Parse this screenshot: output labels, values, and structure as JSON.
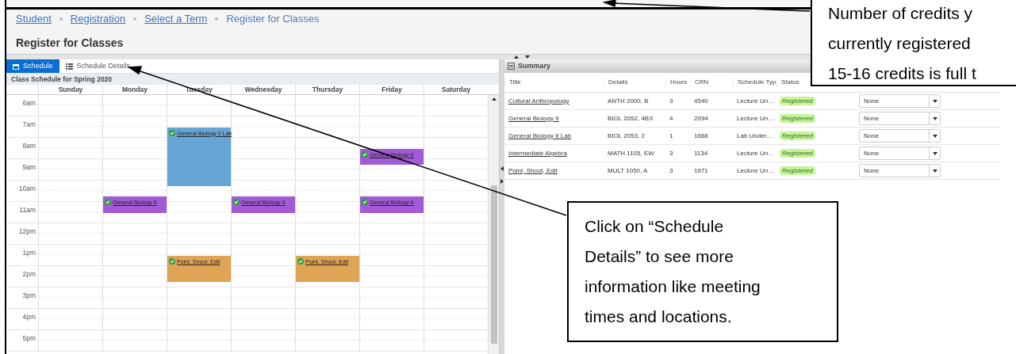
{
  "breadcrumbs": [
    {
      "label": "Student",
      "link": true
    },
    {
      "label": "Registration",
      "link": true
    },
    {
      "label": "Select a Term",
      "link": true
    },
    {
      "label": "Register for Classes",
      "link": false
    }
  ],
  "page_title": "Register for Classes",
  "tabs": [
    {
      "label": "Schedule",
      "selected": true
    },
    {
      "label": "Schedule Details",
      "selected": false
    }
  ],
  "schedule": {
    "title": "Class Schedule for Spring 2020",
    "hours": [
      "6am",
      "7am",
      "8am",
      "9am",
      "10am",
      "11am",
      "12pm",
      "1pm",
      "2pm",
      "3pm",
      "4pm",
      "5pm"
    ],
    "days": [
      {
        "name": "Sunday"
      },
      {
        "name": "Monday",
        "events": [
          {
            "title": "General Biology II",
            "color": "#a25ad6"
          }
        ]
      },
      {
        "name": "Tuesday",
        "events": [
          {
            "title": "General Biology II Lab",
            "color": "#66a5d6"
          },
          {
            "title": "Point, Shoot, Edit",
            "color": "#e0a456"
          }
        ]
      },
      {
        "name": "Wednesday",
        "events": [
          {
            "title": "General Biology II",
            "color": "#a25ad6"
          }
        ]
      },
      {
        "name": "Thursday",
        "events": [
          {
            "title": "Point, Shoot, Edit",
            "color": "#e0a456"
          }
        ]
      },
      {
        "name": "Friday",
        "events": [
          {
            "title": "General Biology II",
            "color": "#a25ad6"
          },
          {
            "title": "General Biology II",
            "color": "#a25ad6"
          }
        ]
      },
      {
        "name": "Saturday"
      }
    ]
  },
  "summary": {
    "title": "Summary",
    "columns": [
      "Title",
      "Details",
      "Hours",
      "CRN",
      "Schedule Typ",
      "Status"
    ],
    "rows": [
      {
        "title": "Cultural Anthropology",
        "details": "ANTH 2000, B",
        "hours": "3",
        "crn": "4540",
        "schedule_type": "Lecture Un…",
        "status": "Registered",
        "action": "None"
      },
      {
        "title": "General Biology II",
        "details": "BIOL 2052, 4BX",
        "hours": "4",
        "crn": "2094",
        "schedule_type": "Lecture Un…",
        "status": "Registered",
        "action": "None"
      },
      {
        "title": "General Biology II Lab",
        "details": "BIOL 2053, 2",
        "hours": "1",
        "crn": "1668",
        "schedule_type": "Lab Under…",
        "status": "Registered",
        "action": "None"
      },
      {
        "title": "Intermediate Algebra",
        "details": "MATH 1105, EW",
        "hours": "3",
        "crn": "1134",
        "schedule_type": "Lecture Un…",
        "status": "Registered",
        "action": "None"
      },
      {
        "title": "Point, Shoot, Edit",
        "details": "MULT 1050, A",
        "hours": "3",
        "crn": "1971",
        "schedule_type": "Lecture Un…",
        "status": "Registered",
        "action": "None"
      }
    ]
  },
  "callouts": [
    {
      "lines": [
        "Number of credits y",
        "currently registered",
        "15-16 credits is full t"
      ]
    },
    {
      "lines": [
        "Click on “Schedule",
        "Details” to see more",
        "information like meeting",
        "times and locations."
      ]
    }
  ]
}
